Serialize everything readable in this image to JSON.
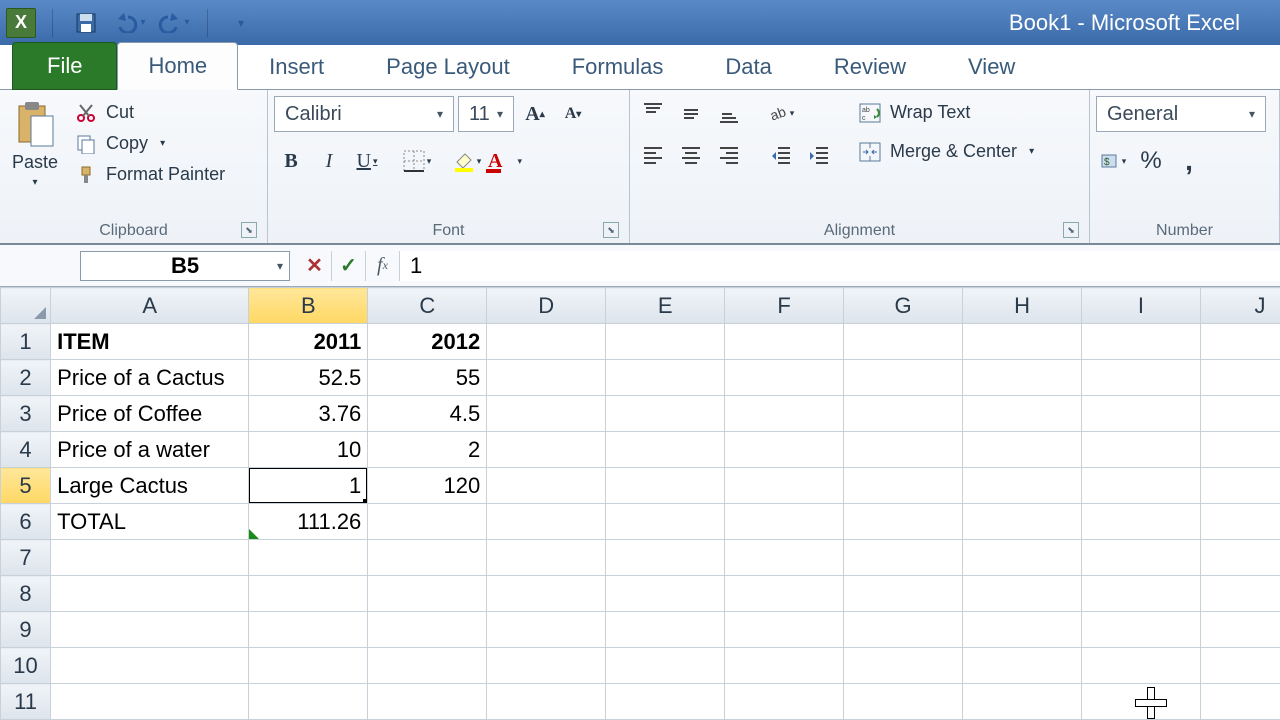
{
  "app": {
    "title": "Book1 - Microsoft Excel"
  },
  "qat": {
    "excel_letter": "X"
  },
  "tabs": {
    "file": "File",
    "home": "Home",
    "insert": "Insert",
    "page_layout": "Page Layout",
    "formulas": "Formulas",
    "data": "Data",
    "review": "Review",
    "view": "View"
  },
  "ribbon": {
    "clipboard": {
      "paste": "Paste",
      "cut": "Cut",
      "copy": "Copy",
      "format_painter": "Format Painter",
      "label": "Clipboard"
    },
    "font": {
      "name": "Calibri",
      "size": "11",
      "label": "Font"
    },
    "alignment": {
      "wrap_text": "Wrap Text",
      "merge_center": "Merge & Center",
      "label": "Alignment"
    },
    "number": {
      "format": "General",
      "label": "Number",
      "percent": "%",
      "comma": ","
    }
  },
  "formula_bar": {
    "namebox": "B5",
    "value": "1"
  },
  "columns": [
    "A",
    "B",
    "C",
    "D",
    "E",
    "F",
    "G",
    "H",
    "I",
    "J"
  ],
  "selected_col_index": 1,
  "selected_row_index": 4,
  "rows": [
    {
      "n": "1",
      "cells": [
        {
          "v": "ITEM",
          "bold": true
        },
        {
          "v": "2011",
          "bold": true,
          "num": true
        },
        {
          "v": "2012",
          "bold": true,
          "num": true
        },
        {
          "v": ""
        },
        {
          "v": ""
        },
        {
          "v": ""
        },
        {
          "v": ""
        },
        {
          "v": ""
        },
        {
          "v": ""
        },
        {
          "v": ""
        }
      ]
    },
    {
      "n": "2",
      "cells": [
        {
          "v": "Price of a Cactus"
        },
        {
          "v": "52.5",
          "num": true
        },
        {
          "v": "55",
          "num": true
        },
        {
          "v": ""
        },
        {
          "v": ""
        },
        {
          "v": ""
        },
        {
          "v": ""
        },
        {
          "v": ""
        },
        {
          "v": ""
        },
        {
          "v": ""
        }
      ]
    },
    {
      "n": "3",
      "cells": [
        {
          "v": "Price of Coffee"
        },
        {
          "v": "3.76",
          "num": true
        },
        {
          "v": "4.5",
          "num": true
        },
        {
          "v": ""
        },
        {
          "v": ""
        },
        {
          "v": ""
        },
        {
          "v": ""
        },
        {
          "v": ""
        },
        {
          "v": ""
        },
        {
          "v": ""
        }
      ]
    },
    {
      "n": "4",
      "cells": [
        {
          "v": "Price of a water"
        },
        {
          "v": "10",
          "num": true
        },
        {
          "v": "2",
          "num": true
        },
        {
          "v": ""
        },
        {
          "v": ""
        },
        {
          "v": ""
        },
        {
          "v": ""
        },
        {
          "v": ""
        },
        {
          "v": ""
        },
        {
          "v": ""
        }
      ]
    },
    {
      "n": "5",
      "cells": [
        {
          "v": "Large Cactus"
        },
        {
          "v": "1",
          "num": true,
          "active": true
        },
        {
          "v": "120",
          "num": true
        },
        {
          "v": ""
        },
        {
          "v": ""
        },
        {
          "v": ""
        },
        {
          "v": ""
        },
        {
          "v": ""
        },
        {
          "v": ""
        },
        {
          "v": ""
        }
      ]
    },
    {
      "n": "6",
      "cells": [
        {
          "v": "TOTAL"
        },
        {
          "v": "111.26",
          "num": true,
          "err": true
        },
        {
          "v": ""
        },
        {
          "v": ""
        },
        {
          "v": ""
        },
        {
          "v": ""
        },
        {
          "v": ""
        },
        {
          "v": ""
        },
        {
          "v": ""
        },
        {
          "v": ""
        }
      ]
    },
    {
      "n": "7",
      "cells": [
        {
          "v": ""
        },
        {
          "v": ""
        },
        {
          "v": ""
        },
        {
          "v": ""
        },
        {
          "v": ""
        },
        {
          "v": ""
        },
        {
          "v": ""
        },
        {
          "v": ""
        },
        {
          "v": ""
        },
        {
          "v": ""
        }
      ]
    },
    {
      "n": "8",
      "cells": [
        {
          "v": ""
        },
        {
          "v": ""
        },
        {
          "v": ""
        },
        {
          "v": ""
        },
        {
          "v": ""
        },
        {
          "v": ""
        },
        {
          "v": ""
        },
        {
          "v": ""
        },
        {
          "v": ""
        },
        {
          "v": ""
        }
      ]
    },
    {
      "n": "9",
      "cells": [
        {
          "v": ""
        },
        {
          "v": ""
        },
        {
          "v": ""
        },
        {
          "v": ""
        },
        {
          "v": ""
        },
        {
          "v": ""
        },
        {
          "v": ""
        },
        {
          "v": ""
        },
        {
          "v": ""
        },
        {
          "v": ""
        }
      ]
    },
    {
      "n": "10",
      "cells": [
        {
          "v": ""
        },
        {
          "v": ""
        },
        {
          "v": ""
        },
        {
          "v": ""
        },
        {
          "v": ""
        },
        {
          "v": ""
        },
        {
          "v": ""
        },
        {
          "v": ""
        },
        {
          "v": ""
        },
        {
          "v": ""
        }
      ]
    },
    {
      "n": "11",
      "cells": [
        {
          "v": ""
        },
        {
          "v": ""
        },
        {
          "v": ""
        },
        {
          "v": ""
        },
        {
          "v": ""
        },
        {
          "v": ""
        },
        {
          "v": ""
        },
        {
          "v": ""
        },
        {
          "v": ""
        },
        {
          "v": ""
        }
      ]
    }
  ],
  "chart_data": {
    "type": "table",
    "title": "",
    "columns": [
      "ITEM",
      "2011",
      "2012"
    ],
    "rows": [
      [
        "Price of a Cactus",
        52.5,
        55
      ],
      [
        "Price of Coffee",
        3.76,
        4.5
      ],
      [
        "Price of a water",
        10,
        2
      ],
      [
        "Large Cactus",
        1,
        120
      ],
      [
        "TOTAL",
        111.26,
        null
      ]
    ]
  }
}
